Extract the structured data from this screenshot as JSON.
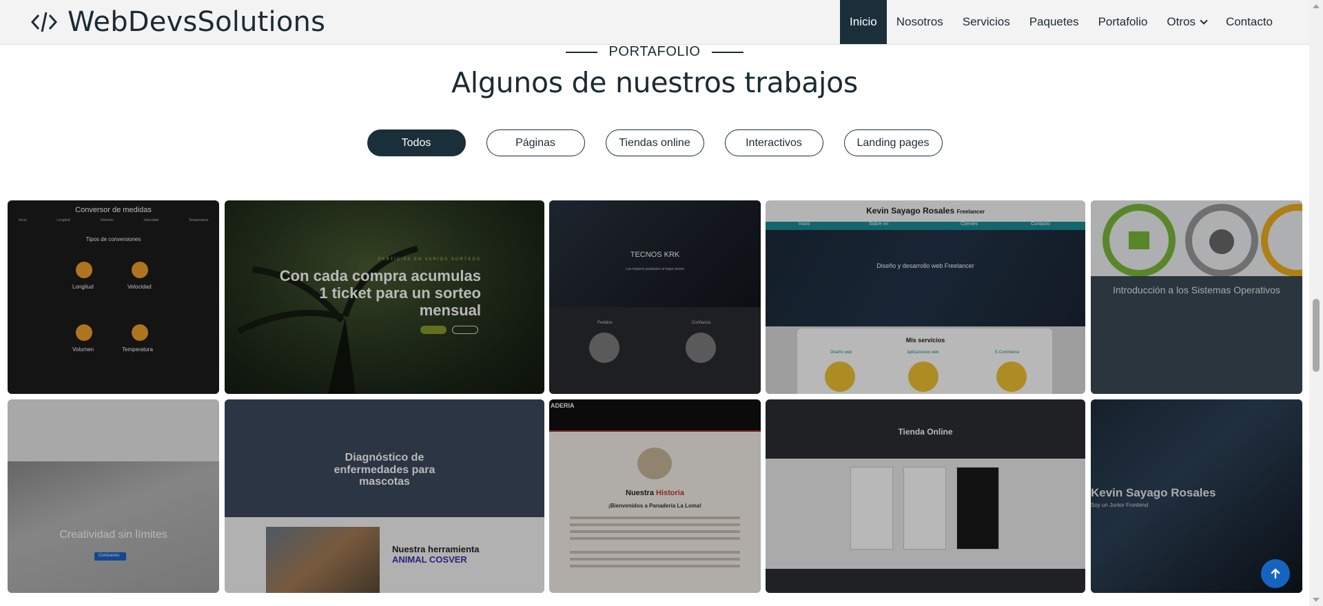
{
  "brand": {
    "name": "WebDevsSolutions",
    "icon": "code-brackets-icon"
  },
  "nav": {
    "items": [
      {
        "label": "Inicio",
        "active": true
      },
      {
        "label": "Nosotros"
      },
      {
        "label": "Servicios"
      },
      {
        "label": "Paquetes"
      },
      {
        "label": "Portafolio"
      },
      {
        "label": "Otros",
        "dropdown": true
      },
      {
        "label": "Contacto"
      }
    ]
  },
  "section": {
    "eyebrow": "PORTAFOLIO",
    "title": "Algunos de nuestros trabajos",
    "filters": [
      "Todos",
      "Páginas",
      "Tiendas online",
      "Interactivos",
      "Landing pages"
    ],
    "active_filter": "Todos"
  },
  "projects": {
    "converter": {
      "title": "Conversor de medidas",
      "menu": [
        "Inicio",
        "Longitud",
        "Volumen",
        "Velocidad",
        "Temperatura"
      ],
      "subtitle": "Tipos de conversiones",
      "items": [
        "Longitud",
        "Velocidad",
        "Volumen",
        "Temperatura"
      ]
    },
    "raffle": {
      "kicker": "PARTICIPA EN VARIOS SORTEOS",
      "headline": "Con cada compra acumulas 1 ticket para un sorteo mensual"
    },
    "tecnos": {
      "title": "TECNOS KRK",
      "subtitle": "Los mejores productos al mejor precio",
      "captions": [
        "Pedidos",
        "Confianza"
      ]
    },
    "freelancer": {
      "name": "Kevin Sayago Rosales",
      "tag": "Freelancer",
      "nav": [
        "Inicio",
        "Sobre mi",
        "Clientes",
        "Contacto"
      ],
      "headline": "Diseño y desarrollo web Freelancer",
      "services_title": "Mis servicios",
      "services": [
        "Diseño web",
        "Aplicaciones web",
        "E-Commerce"
      ]
    },
    "os": {
      "title": "Introducción a los Sistemas Operativos"
    },
    "creative": {
      "slogan": "Creatividad sin límites",
      "button": "Conócenos"
    },
    "pets": {
      "title": "Diagnóstico de enfermedades para mascotas",
      "tool_line1": "Nuestra herramienta",
      "tool_line2": "ANIMAL COSVER"
    },
    "bakery": {
      "brand": "ADERIA",
      "history_prefix": "Nuestra ",
      "history_word": "Historia",
      "welcome": "¡Bienvenidos a Panadería La Loma!"
    },
    "shop": {
      "title": "Tienda Online"
    },
    "profile": {
      "name": "Kevin Sayago Rosales",
      "tagline": "Soy un Junior Frontend"
    }
  },
  "colors": {
    "primary": "#1b2f3b",
    "accent": "#1565c0",
    "gold": "#f1c232",
    "teal": "#1a8e96"
  }
}
